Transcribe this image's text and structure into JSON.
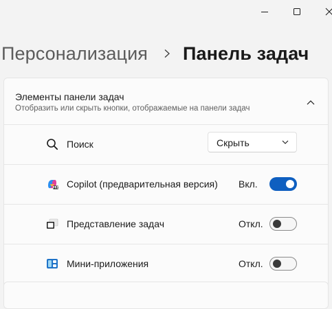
{
  "window": {
    "controls": {
      "minimize_icon": "minimize-icon",
      "maximize_icon": "maximize-icon",
      "close_icon": "close-icon"
    }
  },
  "breadcrumb": {
    "parent": "Персонализация",
    "current": "Панель задач",
    "separator_icon": "chevron-right-icon"
  },
  "section": {
    "title": "Элементы панели задач",
    "subtitle": "Отобразить или скрыть кнопки, отображаемые на панели задач",
    "expanded": true,
    "collapse_icon": "chevron-up-icon",
    "items": [
      {
        "label": "Поиск",
        "icon": "search-icon",
        "control": "dropdown",
        "value": "Скрыть"
      },
      {
        "label": "Copilot (предварительная версия)",
        "icon": "copilot-icon",
        "control": "toggle",
        "state_text": "Вкл.",
        "on": true
      },
      {
        "label": "Представление задач",
        "icon": "task-view-icon",
        "control": "toggle",
        "state_text": "Откл.",
        "on": false
      },
      {
        "label": "Мини-приложения",
        "icon": "widgets-icon",
        "control": "toggle",
        "state_text": "Откл.",
        "on": false
      }
    ]
  },
  "colors": {
    "accent": "#0f5fc0",
    "background": "#f3f3f3",
    "card": "#fbfbfb"
  }
}
